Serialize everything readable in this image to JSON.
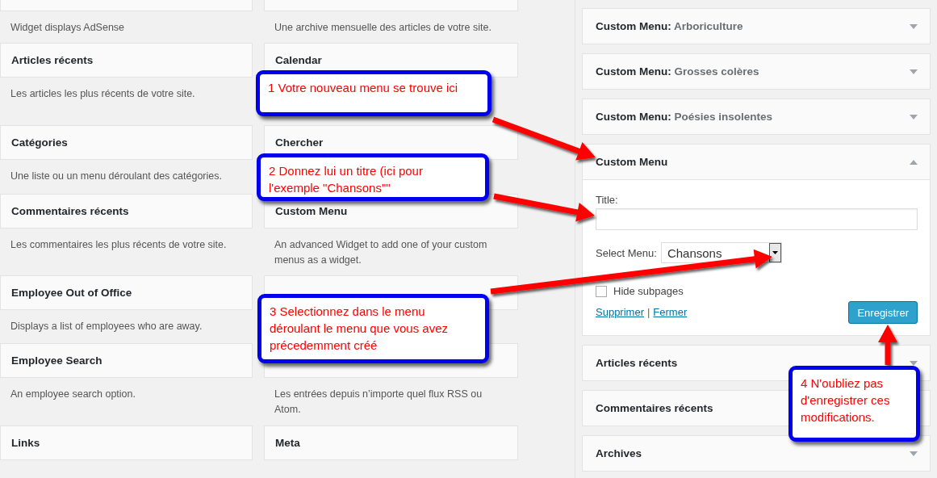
{
  "available_widgets": [
    {
      "left": {
        "description": "Widget displays AdSense"
      },
      "right": {
        "description": "Une archive mensuelle des articles de votre site."
      }
    },
    {
      "left": {
        "title": "Articles récents",
        "description": "Les articles les plus récents de votre site."
      },
      "right": {
        "title": "Calendar"
      }
    },
    {
      "left": {
        "title": "Catégories",
        "description": "Une liste ou un menu déroulant des catégories."
      },
      "right": {
        "title": "Chercher"
      }
    },
    {
      "left": {
        "title": "Commentaires récents",
        "description": "Les commentaires les plus récents de votre site."
      },
      "right": {
        "title": "Custom Menu",
        "description": "An advanced Widget to add one of your custom menus as a widget."
      }
    },
    {
      "left": {
        "title": "Employee Out of Office",
        "description": "Displays a list of employees who are away."
      }
    },
    {
      "left": {
        "title": "Employee Search",
        "description": "An employee search option."
      },
      "right": {
        "description": "Les entrées depuis n’importe quel flux RSS ou Atom."
      }
    },
    {
      "left": {
        "title": "Links"
      },
      "right": {
        "title": "Meta"
      }
    }
  ],
  "sidebar_widgets": [
    {
      "title": "**Custom Menu:** Arboriculture",
      "expanded": false
    },
    {
      "title": "**Custom Menu:** Grosses colères",
      "expanded": false
    },
    {
      "title": "**Custom Menu:** Poésies insolentes",
      "expanded": false
    },
    {
      "title": "**Custom Menu**",
      "expanded": true,
      "form": {
        "title_label": "Title:",
        "select_label": "Select Menu:",
        "select_value": "Chansons",
        "checkbox_label": "Hide subpages",
        "checkbox_checked": false,
        "links": [
          "Supprimer",
          "Fermer"
        ],
        "link_separator": "|",
        "save_button": "Enregistrer"
      }
    },
    {
      "title": "**Articles récents**",
      "expanded": false
    },
    {
      "title": "**Commentaires récents**",
      "expanded": false
    },
    {
      "title": "**Archives**",
      "expanded": false
    }
  ],
  "callouts": [
    {
      "lines": [
        "1 Votre nouveau menu se trouve ici"
      ]
    },
    {
      "lines": [
        "2 Donnez lui un titre (ici pour",
        "l'exemple \"Chansons\"\""
      ]
    },
    {
      "lines": [
        "3 Selectionnez dans le menu",
        "déroulant le menu que vous avez",
        "précedemment créé"
      ]
    },
    {
      "lines": [
        "4 N'oubliez pas",
        "d'enregistrer ces",
        "modifications."
      ]
    }
  ]
}
